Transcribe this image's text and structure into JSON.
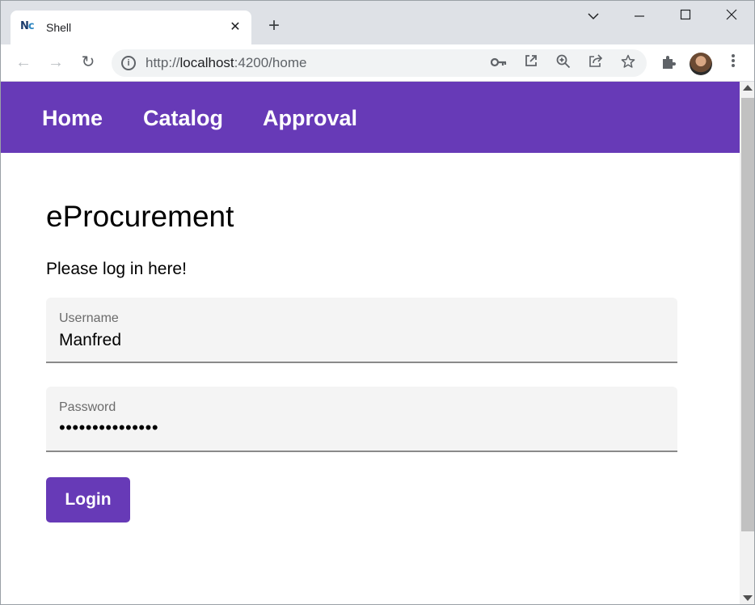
{
  "browser": {
    "tab": {
      "favicon": "Nc",
      "title": "Shell",
      "close": "✕"
    },
    "new_tab": "+",
    "window_controls": {
      "tabs_menu": "⌵",
      "minimize": "—",
      "maximize": "☐",
      "close": "✕"
    },
    "toolbar": {
      "back": "←",
      "forward": "→",
      "reload": "↻",
      "url_scheme": "http://",
      "url_host": "localhost",
      "url_rest": ":4200/home",
      "icons": [
        "key-icon",
        "open-in-new-icon",
        "zoom-icon",
        "share-icon",
        "star-icon",
        "extensions-icon",
        "avatar",
        "menu-icon"
      ]
    }
  },
  "app": {
    "nav": [
      "Home",
      "Catalog",
      "Approval"
    ],
    "title": "eProcurement",
    "subtitle": "Please log in here!",
    "username": {
      "label": "Username",
      "value": "Manfred"
    },
    "password": {
      "label": "Password",
      "value": "•••••••••••••••"
    },
    "login_label": "Login",
    "accent_color": "#673ab7"
  }
}
